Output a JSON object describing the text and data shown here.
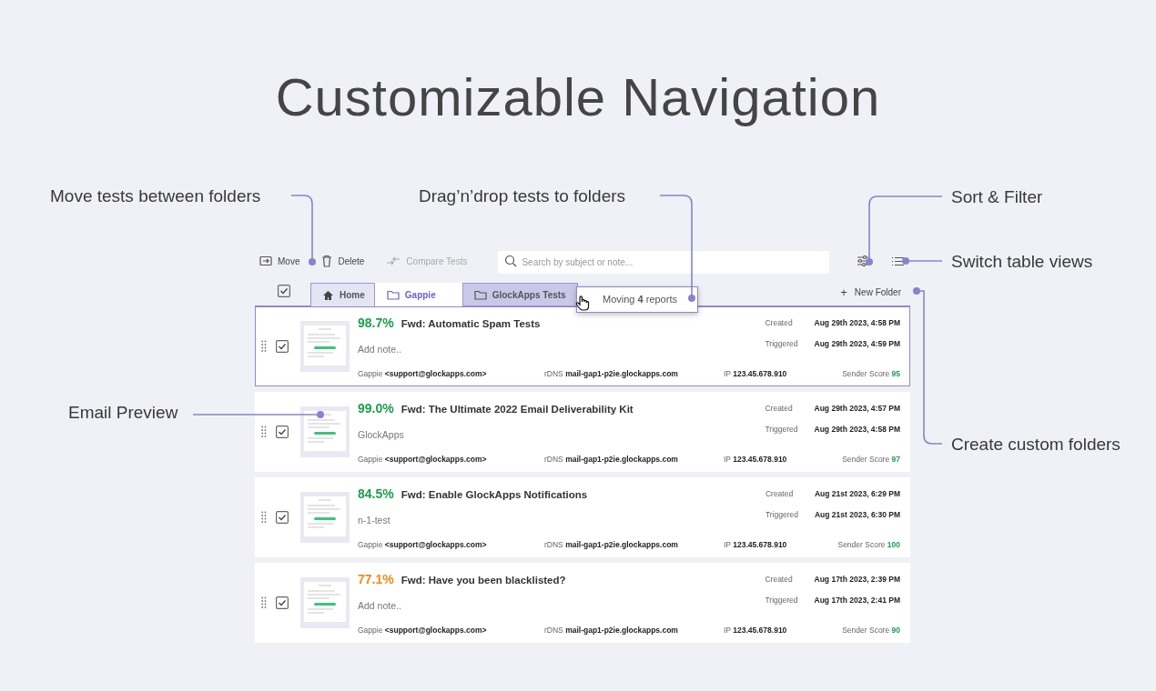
{
  "title": "Customizable Navigation",
  "callouts": [
    {
      "text": "Move tests between folders",
      "kind": "move"
    },
    {
      "text": "Drag’n’drop tests to folders",
      "kind": "drag"
    },
    {
      "text": "Sort & Filter",
      "kind": "sort"
    },
    {
      "text": "Switch table views",
      "kind": "views"
    },
    {
      "text": "Email Preview",
      "kind": "preview"
    },
    {
      "text": "Create custom folders",
      "kind": "folders"
    }
  ],
  "toolbar": {
    "buttons": [
      {
        "label": "Move",
        "kind": "move",
        "disabled": false
      },
      {
        "label": "Delete",
        "kind": "delete",
        "disabled": false
      },
      {
        "label": "Compare Tests",
        "kind": "compare",
        "disabled": true
      }
    ],
    "search": {
      "placeholder": "Search by subject or note..."
    }
  },
  "select_all": {
    "checked": true
  },
  "tabs": [
    {
      "label": "Home",
      "kind": "home",
      "selected": false,
      "drop_target": false
    },
    {
      "label": "Gappie",
      "kind": "folder",
      "selected": true,
      "drop_target": false
    },
    {
      "label": "GlockApps Tests",
      "kind": "folder",
      "selected": false,
      "drop_target": true
    }
  ],
  "drag_tooltip": "Moving **4** reports",
  "new_folder": {
    "icon": "+",
    "label": "New Folder"
  },
  "tests": [
    {
      "score": "98.7%",
      "color": "#1a9f4b",
      "subject": "Fwd: Automatic Spam Tests",
      "note": "Add note..",
      "checked": true,
      "selected": true,
      "created_label": "Created",
      "created": "Aug 29th 2023, 4:58 PM",
      "triggered_label": "Triggered",
      "triggered": "Aug 29th 2023, 4:59 PM",
      "sender_name": "Gappie",
      "sender_email": "<support@glockapps.com>",
      "rdns_label": "rDNS",
      "rdns": "mail-gap1-p2ie.glockapps.com",
      "ip_label": "IP",
      "ip": "123.45.678.910",
      "sender_score_label": "Sender Score",
      "sender_score": "95"
    },
    {
      "score": "99.0%",
      "color": "#1a9f4b",
      "subject": "Fwd: The Ultimate 2022 Email Deliverability Kit",
      "note": "GlockApps",
      "checked": true,
      "selected": false,
      "created_label": "Created",
      "created": "Aug 29th 2023, 4:57 PM",
      "triggered_label": "Triggered",
      "triggered": "Aug 29th 2023, 4:58 PM",
      "sender_name": "Gappie",
      "sender_email": "<support@glockapps.com>",
      "rdns_label": "rDNS",
      "rdns": "mail-gap1-p2ie.glockapps.com",
      "ip_label": "IP",
      "ip": "123.45.678.910",
      "sender_score_label": "Sender Score",
      "sender_score": "97"
    },
    {
      "score": "84.5%",
      "color": "#1a9f4b",
      "subject": "Fwd: Enable GlockApps Notifications",
      "note": "n-1-test",
      "checked": true,
      "selected": false,
      "created_label": "Created",
      "created": "Aug 21st 2023, 6:29 PM",
      "triggered_label": "Triggered",
      "triggered": "Aug 21st 2023, 6:30 PM",
      "sender_name": "Gappie",
      "sender_email": "<support@glockapps.com>",
      "rdns_label": "rDNS",
      "rdns": "mail-gap1-p2ie.glockapps.com",
      "ip_label": "IP",
      "ip": "123.45.678.910",
      "sender_score_label": "Sender Score",
      "sender_score": "100"
    },
    {
      "score": "77.1%",
      "color": "#f08a1c",
      "subject": "Fwd: Have you been blacklisted?",
      "note": "Add note..",
      "checked": true,
      "selected": false,
      "created_label": "Created",
      "created": "Aug 17th 2023, 2:39 PM",
      "triggered_label": "Triggered",
      "triggered": "Aug 17th 2023, 2:41 PM",
      "sender_name": "Gappie",
      "sender_email": "<support@glockapps.com>",
      "rdns_label": "rDNS",
      "rdns": "mail-gap1-p2ie.glockapps.com",
      "ip_label": "IP",
      "ip": "123.45.678.910",
      "sender_score_label": "Sender Score",
      "sender_score": "90"
    }
  ]
}
